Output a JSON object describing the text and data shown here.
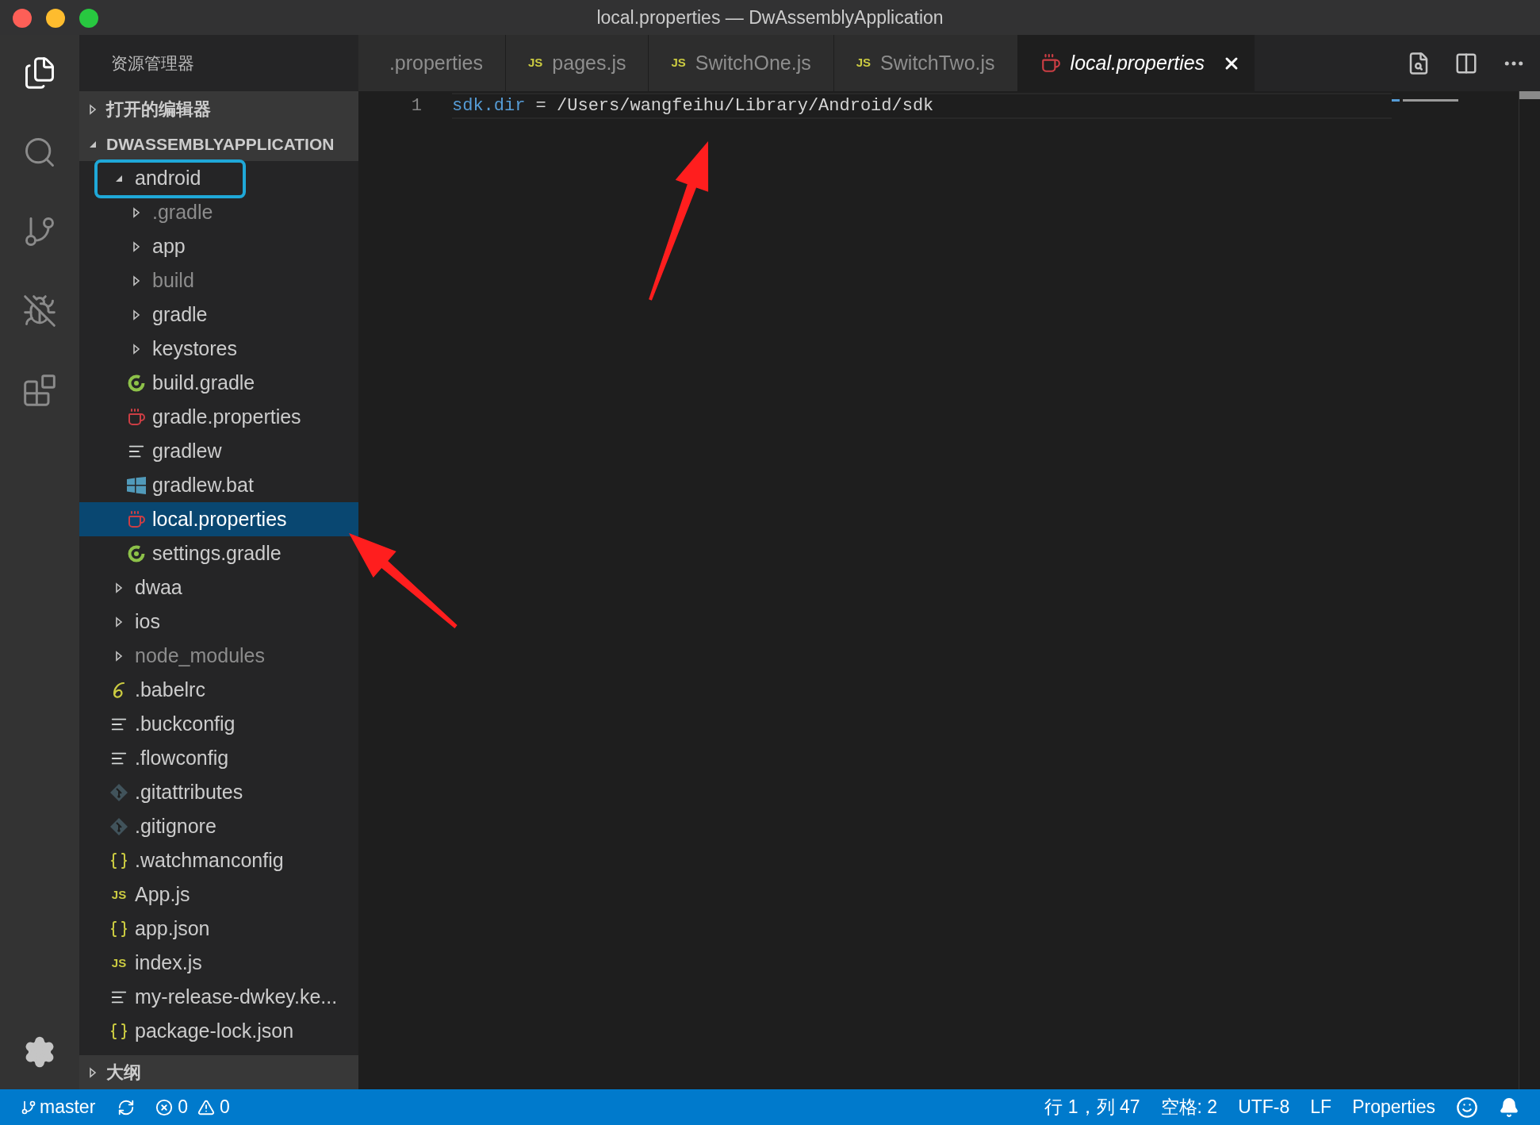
{
  "window": {
    "title": "local.properties — DwAssemblyApplication"
  },
  "activity_bar": [
    {
      "kind": "explorer",
      "selected": true
    },
    {
      "kind": "search",
      "selected": false
    },
    {
      "kind": "scm",
      "selected": false
    },
    {
      "kind": "debug",
      "selected": false
    },
    {
      "kind": "extensions",
      "selected": false
    }
  ],
  "sidebar": {
    "title": "资源管理器",
    "open_editors": {
      "label": "打开的编辑器",
      "expanded": false
    },
    "folder": {
      "label": "DWASSEMBLYAPPLICATION",
      "expanded": true,
      "tree": [
        {
          "name": "android",
          "kind": "folder",
          "expanded": true,
          "dimmed": false,
          "selected": false,
          "children": [
            {
              "name": ".gradle",
              "kind": "folder",
              "expanded": false,
              "dimmed": true,
              "selected": false
            },
            {
              "name": "app",
              "kind": "folder",
              "expanded": false,
              "dimmed": false,
              "selected": false
            },
            {
              "name": "build",
              "kind": "folder",
              "expanded": false,
              "dimmed": true,
              "selected": false
            },
            {
              "name": "gradle",
              "kind": "folder",
              "expanded": false,
              "dimmed": false,
              "selected": false
            },
            {
              "name": "keystores",
              "kind": "folder",
              "expanded": false,
              "dimmed": false,
              "selected": false
            },
            {
              "name": "build.gradle",
              "kind": "gradle",
              "dimmed": false,
              "selected": false
            },
            {
              "name": "gradle.properties",
              "kind": "java",
              "dimmed": false,
              "selected": false
            },
            {
              "name": "gradlew",
              "kind": "text",
              "dimmed": false,
              "selected": false
            },
            {
              "name": "gradlew.bat",
              "kind": "windows",
              "dimmed": false,
              "selected": false
            },
            {
              "name": "local.properties",
              "kind": "java",
              "dimmed": false,
              "selected": true
            },
            {
              "name": "settings.gradle",
              "kind": "gradle",
              "dimmed": false,
              "selected": false
            }
          ]
        },
        {
          "name": "dwaa",
          "kind": "folder",
          "expanded": false,
          "dimmed": false,
          "selected": false
        },
        {
          "name": "ios",
          "kind": "folder",
          "expanded": false,
          "dimmed": false,
          "selected": false
        },
        {
          "name": "node_modules",
          "kind": "folder",
          "expanded": false,
          "dimmed": true,
          "selected": false
        },
        {
          "name": ".babelrc",
          "kind": "babel",
          "dimmed": false,
          "selected": false
        },
        {
          "name": ".buckconfig",
          "kind": "text",
          "dimmed": false,
          "selected": false
        },
        {
          "name": ".flowconfig",
          "kind": "text",
          "dimmed": false,
          "selected": false
        },
        {
          "name": ".gitattributes",
          "kind": "git",
          "dimmed": false,
          "selected": false
        },
        {
          "name": ".gitignore",
          "kind": "git",
          "dimmed": false,
          "selected": false
        },
        {
          "name": ".watchmanconfig",
          "kind": "json",
          "dimmed": false,
          "selected": false
        },
        {
          "name": "App.js",
          "kind": "js",
          "icon_text": "JS",
          "dimmed": false,
          "selected": false
        },
        {
          "name": "app.json",
          "kind": "json",
          "dimmed": false,
          "selected": false
        },
        {
          "name": "index.js",
          "kind": "js",
          "icon_text": "JS",
          "dimmed": false,
          "selected": false
        },
        {
          "name": "my-release-dwkey.ke...",
          "kind": "text",
          "dimmed": false,
          "selected": false
        },
        {
          "name": "package-lock.json",
          "kind": "json",
          "dimmed": false,
          "selected": false
        }
      ]
    },
    "outline": {
      "label": "大纲",
      "expanded": false
    }
  },
  "tabs": [
    {
      "label": ".properties",
      "selected": false
    },
    {
      "label": "pages.js",
      "kind": "js",
      "icon_text": "JS",
      "selected": false
    },
    {
      "label": "SwitchOne.js",
      "kind": "js",
      "icon_text": "JS",
      "selected": false
    },
    {
      "label": "SwitchTwo.js",
      "kind": "js",
      "icon_text": "JS",
      "selected": false
    },
    {
      "label": "local.properties",
      "kind": "java",
      "selected": true
    }
  ],
  "editor": {
    "lines": [
      {
        "number": "1",
        "tokens": [
          {
            "text": "sdk.dir",
            "kind": "key"
          },
          {
            "text": " = /Users/wangfeihu/Library/Android/sdk",
            "kind": "value"
          }
        ]
      }
    ]
  },
  "status_bar": {
    "branch": "master",
    "errors": "0",
    "warnings": "0",
    "right": [
      "行 1，列 47",
      "空格: 2",
      "UTF-8",
      "LF",
      "Properties"
    ]
  }
}
